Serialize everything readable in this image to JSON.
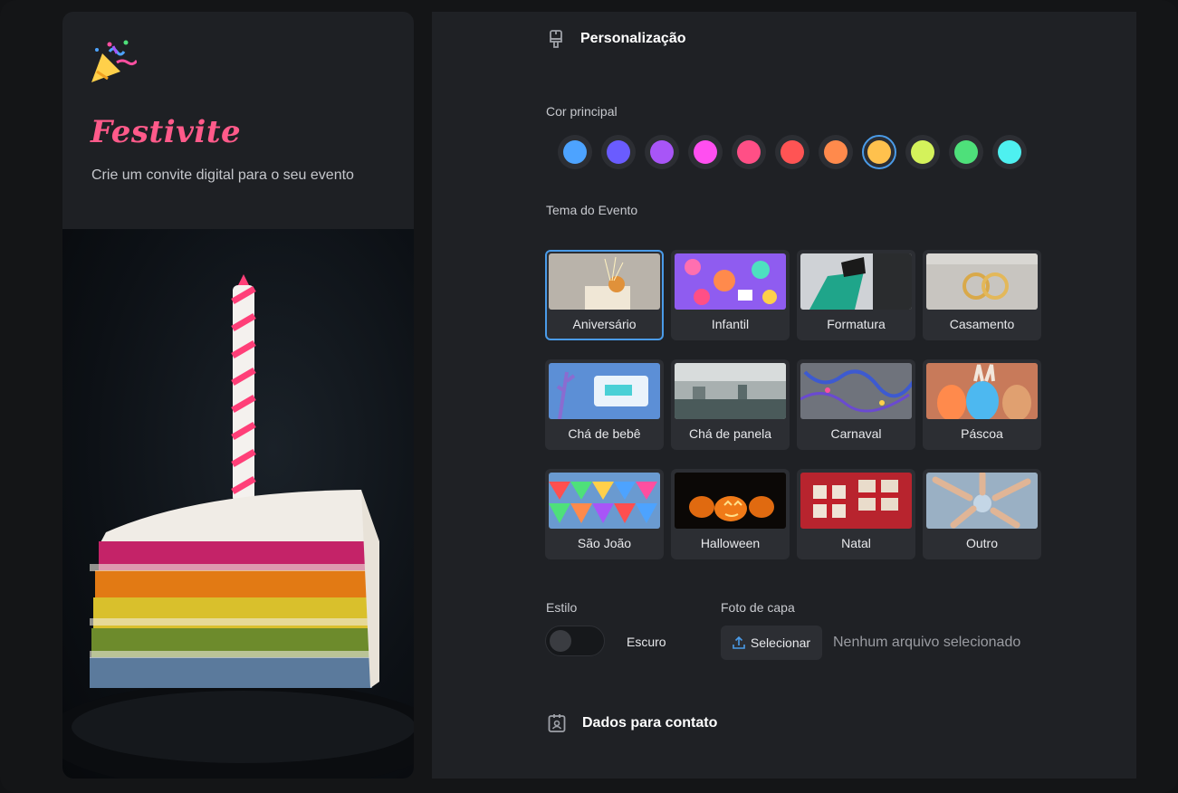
{
  "brand": {
    "name": "Festivite",
    "tagline": "Crie um convite digital para o seu evento"
  },
  "sections": {
    "personalizacao": "Personalização",
    "contato": "Dados para contato"
  },
  "color_label": "Cor principal",
  "colors": [
    "#4da3ff",
    "#6a5cff",
    "#a855f7",
    "#ff4ff0",
    "#ff4f86",
    "#ff5454",
    "#ff8a4c",
    "#ffc14d",
    "#d4f25b",
    "#4ee07a",
    "#4ef0f0"
  ],
  "selected_color_index": 7,
  "theme_label": "Tema do Evento",
  "themes": [
    {
      "label": "Aniversário"
    },
    {
      "label": "Infantil"
    },
    {
      "label": "Formatura"
    },
    {
      "label": "Casamento"
    },
    {
      "label": "Chá de bebê"
    },
    {
      "label": "Chá de panela"
    },
    {
      "label": "Carnaval"
    },
    {
      "label": "Páscoa"
    },
    {
      "label": "São João"
    },
    {
      "label": "Halloween"
    },
    {
      "label": "Natal"
    },
    {
      "label": "Outro"
    }
  ],
  "selected_theme": "Aniversário",
  "style": {
    "label": "Estilo",
    "value": "Escuro"
  },
  "cover": {
    "label": "Foto de capa",
    "button": "Selecionar",
    "status": "Nenhum arquivo selecionado"
  }
}
